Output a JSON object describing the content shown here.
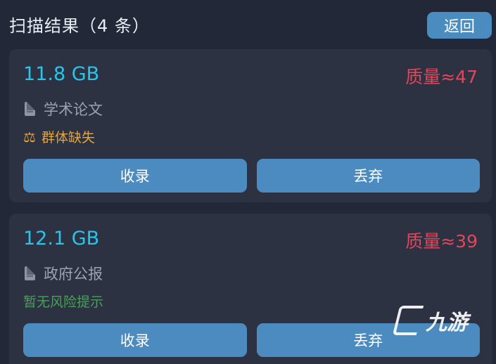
{
  "header": {
    "title": "扫描结果（4 条）",
    "back_label": "返回"
  },
  "results": [
    {
      "size": "11.8 GB",
      "quality": "质量≈47",
      "category": "学术论文",
      "risk": "群体缺失",
      "risk_icon": "scale-icon",
      "accept_label": "收录",
      "discard_label": "丢弃"
    },
    {
      "size": "12.1 GB",
      "quality": "质量≈39",
      "category": "政府公报",
      "risk": "暂无风险提示",
      "accept_label": "收录",
      "discard_label": "丢弃"
    }
  ],
  "watermark": {
    "text": "九游"
  },
  "colors": {
    "background": "#232838",
    "card": "#2c3242",
    "accent_button": "#4b8bbf",
    "size_text": "#2cc3e8",
    "quality_text": "#e0475a",
    "warning_text": "#e5a43a",
    "ok_text": "#4aa05a"
  }
}
